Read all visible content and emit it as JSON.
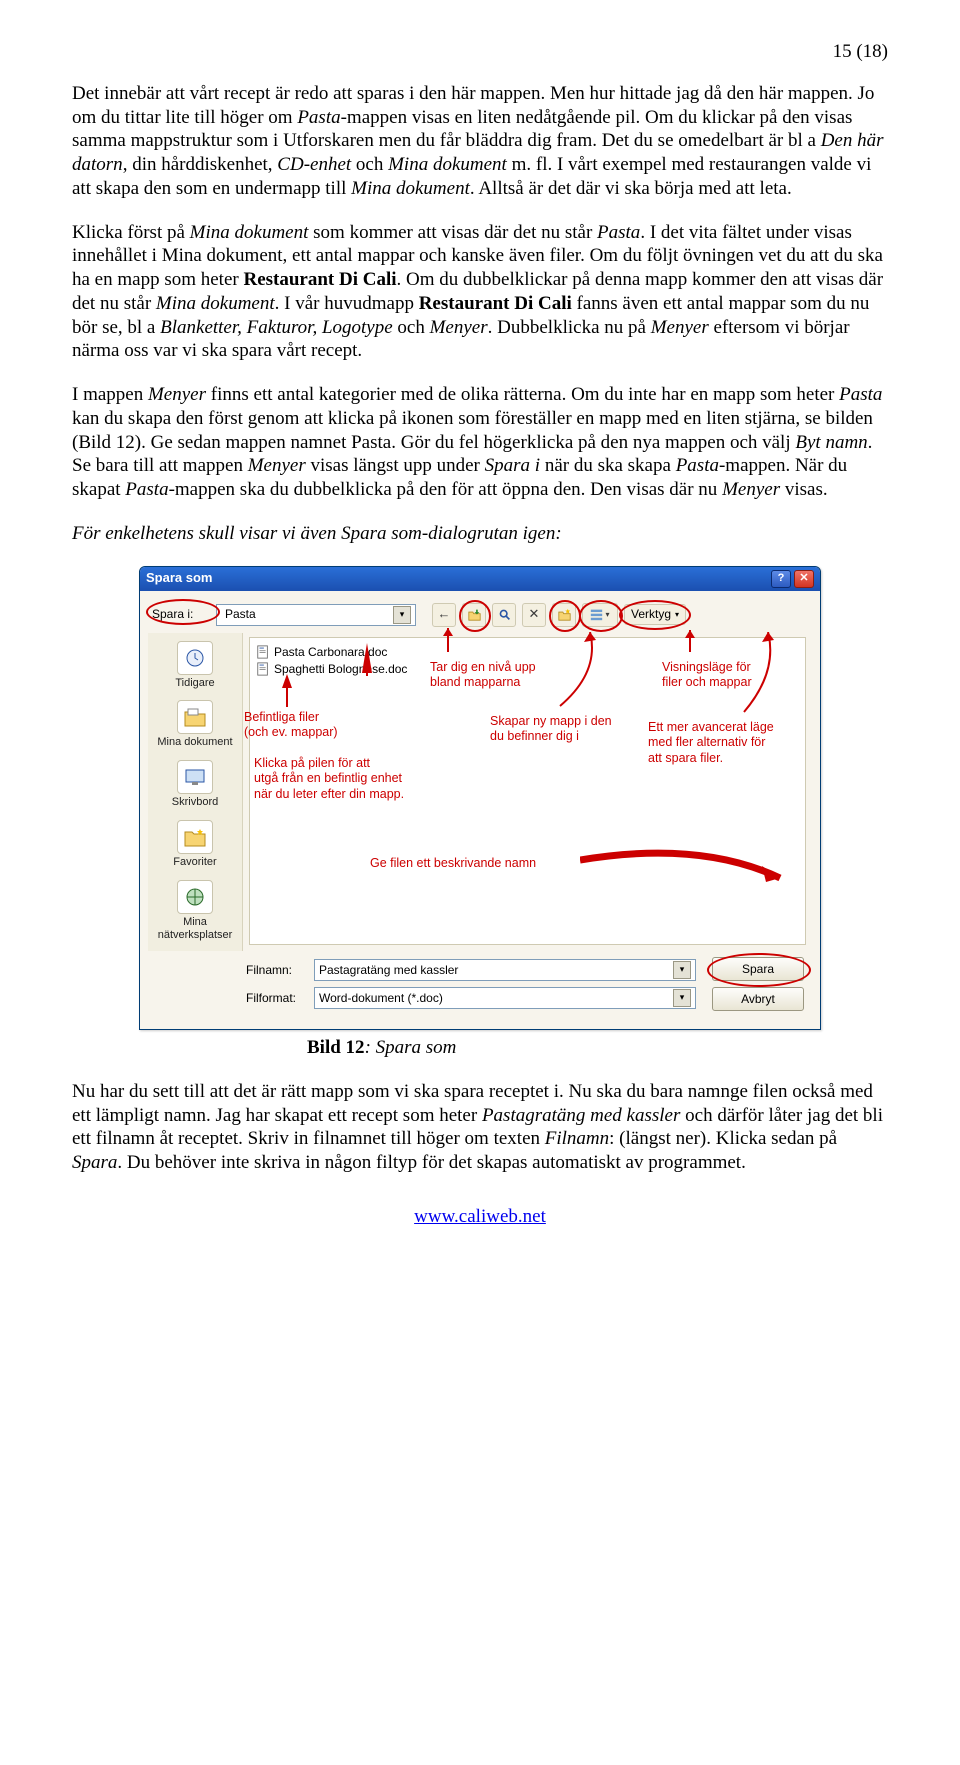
{
  "page_no": "15 (18)",
  "p1_a": "Det innebär att vårt recept är redo att sparas i den här mappen. Men hur hittade jag då den här mappen. Jo om du tittar lite till höger om ",
  "p1_i1": "Pasta",
  "p1_b": "-mappen visas en liten nedåtgående pil. Om du klickar på den visas samma mappstruktur som i Utforskaren men du får bläddra dig fram. Det du se omedelbart är bl a ",
  "p1_i2": "Den här datorn",
  "p1_c": ", din hårddiskenhet, ",
  "p1_i3": "CD-enhet ",
  "p1_d": "och ",
  "p1_i4": "Mina dokument",
  "p1_e": " m. fl. I vårt exempel med restaurangen valde vi att skapa den som en undermapp till ",
  "p1_i5": "Mina dokument",
  "p1_f": ". Alltså är det där vi ska börja med att leta.",
  "p2_a": "Klicka först på ",
  "p2_i1": "Mina dokument",
  "p2_b": " som kommer att visas där det nu står ",
  "p2_i2": "Pasta",
  "p2_c": ". I det vita fältet under visas innehållet i Mina dokument, ett antal mappar och kanske även filer. Om du följt övningen vet du att du ska ha en mapp som heter ",
  "p2_s1": "Restaurant Di Cali",
  "p2_d": ". Om du dubbelklickar på denna mapp kommer den att visas där det nu står ",
  "p2_i3": "Mina dokument",
  "p2_e": ". I vår huvudmapp ",
  "p2_s2": "Restaurant Di Cali",
  "p2_f": " fanns även ett antal mappar som du nu bör se, bl a ",
  "p2_i4": "Blanketter, Fakturor, Logotype ",
  "p2_g": "och ",
  "p2_i5": "Menyer",
  "p2_h": ". Dubbelklicka nu på ",
  "p2_i6": "Menyer",
  "p2_i": " eftersom vi börjar närma oss var vi ska spara vårt recept.",
  "p3_a": "I mappen ",
  "p3_i1": "Menyer ",
  "p3_b": "finns ett antal kategorier med de olika rätterna. Om du inte har en mapp som heter ",
  "p3_i2": "Pasta",
  "p3_c": " kan du skapa den först genom att klicka på ikonen som föreställer en mapp med en liten stjärna, se bilden (Bild 12). Ge sedan mappen namnet Pasta. Gör du fel högerklicka på den nya mappen och välj ",
  "p3_i3": "Byt namn",
  "p3_d": ". Se bara till att mappen ",
  "p3_i4": "Menyer",
  "p3_e": " visas längst upp under ",
  "p3_i5": "Spara i",
  "p3_f": " när du ska skapa ",
  "p3_i6": "Pasta",
  "p3_g": "-mappen. När du skapat ",
  "p3_i7": "Pasta",
  "p3_h": "-mappen ska du dubbelklicka på den för att öppna den. Den visas där nu ",
  "p3_i8": "Menyer",
  "p3_i": " visas.",
  "p4": "För enkelhetens skull visar vi även Spara som-dialogrutan igen:",
  "dlg": {
    "title": "Spara som",
    "save_in_label": "Spara i:",
    "folder": "Pasta",
    "tools": "Verktyg",
    "files": [
      "Pasta Carbonara.doc",
      "Spaghetti Bolognese.doc"
    ],
    "places": [
      "Tidigare",
      "Mina dokument",
      "Skrivbord",
      "Favoriter",
      "Mina nätverksplatser"
    ],
    "filename_label": "Filnamn:",
    "filename": "Pastagratäng med kassler",
    "format_label": "Filformat:",
    "format": "Word-dokument (*.doc)",
    "save_btn": "Spara",
    "cancel_btn": "Avbryt"
  },
  "callouts": {
    "c1": "Befintliga filer\n(och ev. mappar)",
    "c2": "Klicka på pilen för att\nutgå från en befintlig enhet\nnär du leter efter din mapp.",
    "c3": "Tar dig en nivå upp\nbland mapparna",
    "c4": "Skapar ny mapp i den\ndu befinner dig i",
    "c5": "Visningsläge för\nfiler och mappar",
    "c6": "Ett mer avancerat läge\nmed fler alternativ för\natt spara filer.",
    "c7": "Ge filen ett beskrivande namn"
  },
  "caption_b": "Bild 12",
  "caption_i": ": Spara som",
  "p5_a": "Nu har du sett till att det är rätt mapp som vi ska spara receptet i. Nu ska du bara namnge filen också med ett lämpligt namn. Jag har skapat ett recept som heter ",
  "p5_i1": "Pastagratäng med kassler",
  "p5_b": " och därför låter jag det bli ett filnamn åt receptet. Skriv in filnamnet till höger om texten ",
  "p5_i2": "Filnamn",
  "p5_c": ": (längst ner). Klicka sedan på ",
  "p5_i3": "Spara",
  "p5_d": ". Du behöver inte skriva in någon filtyp för det skapas automatiskt av programmet.",
  "footer_link": "www.caliweb.net"
}
